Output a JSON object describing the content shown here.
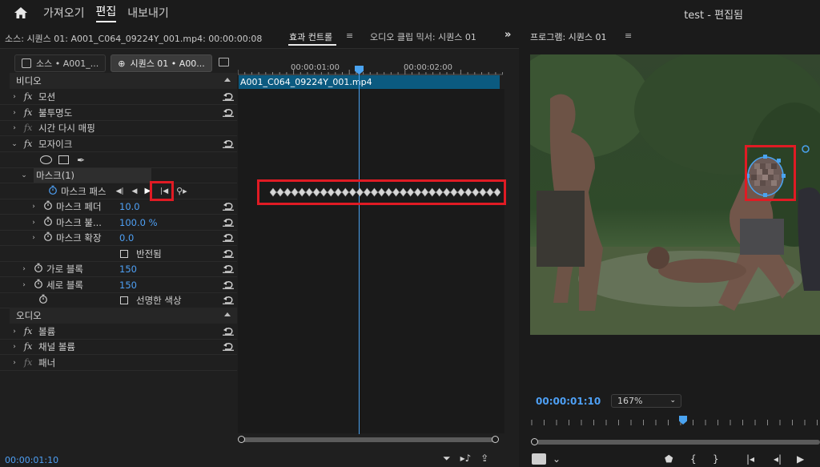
{
  "topbar": {
    "nav": [
      "가져오기",
      "편집",
      "내보내기"
    ],
    "active_index": 1,
    "project_title": "test - 편집됨"
  },
  "left_header": {
    "source_label": "소스: 시퀀스 01: A001_C064_09224Y_001.mp4: 00:00:00:08",
    "tab_effect_controls": "효과 컨트롤",
    "tab_menu_glyph": "≡",
    "tab_audio_mixer": "오디오 클립 믹서: 시퀀스 01",
    "more_glyph": "»"
  },
  "right_header": {
    "program_label": "프로그램: 시퀀스 01",
    "menu_glyph": "≡"
  },
  "clip_selector": {
    "source_btn": "소스 • A001_...",
    "sequence_btn": "시퀀스 01 • A00..."
  },
  "sections": {
    "video": "비디오",
    "audio": "오디오"
  },
  "effects": {
    "motion": "모션",
    "opacity": "불투명도",
    "time_remap": "시간 다시 매핑",
    "mosaic": "모자이크",
    "mask": "마스크(1)",
    "mask_path": "마스크 패스",
    "mask_feather": "마스크 페더",
    "mask_feather_val": "10.0",
    "mask_opacity": "마스크 불...",
    "mask_opacity_val": "100.0 %",
    "mask_expansion": "마스크 확장",
    "mask_expansion_val": "0.0",
    "inverted": "반전됨",
    "horiz_blocks": "가로 블록",
    "horiz_blocks_val": "150",
    "vert_blocks": "세로 블록",
    "vert_blocks_val": "150",
    "sharp_colors": "선명한 색상",
    "volume": "볼륨",
    "channel_volume": "채널 볼륨",
    "panner": "패너",
    "fx": "fx"
  },
  "timeline": {
    "tick1": "00:00:01:00",
    "tick2": "00:00:02:00",
    "clip_name": "A001_C064_09224Y_001.mp4",
    "keyframe_count": 32
  },
  "bottom_left": {
    "timecode": "00:00:01:10"
  },
  "program": {
    "timecode": "00:00:01:10",
    "zoom": "167%"
  },
  "colors": {
    "accent": "#4ea0f5",
    "highlight": "#e01b24",
    "clip": "#0b5a80"
  }
}
